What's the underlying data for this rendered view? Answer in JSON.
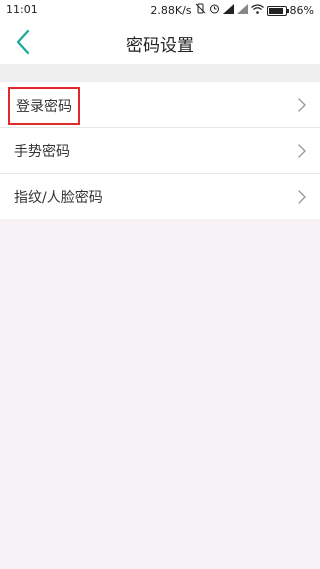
{
  "status_bar": {
    "time": "11:01",
    "network_speed": "2.88K/s",
    "battery_percent": "86%",
    "battery_level": 0.86,
    "icons": [
      "vibrate-off-icon",
      "alarm-icon",
      "signal-icon",
      "signal-icon",
      "wifi-icon",
      "battery-icon"
    ]
  },
  "header": {
    "title": "密码设置",
    "back_icon": "chevron-left-icon"
  },
  "menu": {
    "items": [
      {
        "label": "登录密码",
        "icon": "chevron-right-icon",
        "highlighted": true
      },
      {
        "label": "手势密码",
        "icon": "chevron-right-icon",
        "highlighted": false
      },
      {
        "label": "指纹/人脸密码",
        "icon": "chevron-right-icon",
        "highlighted": false
      }
    ]
  },
  "colors": {
    "accent": "#1aa899",
    "highlight_border": "#e02a2a",
    "page_background": "#f6f1f5"
  }
}
